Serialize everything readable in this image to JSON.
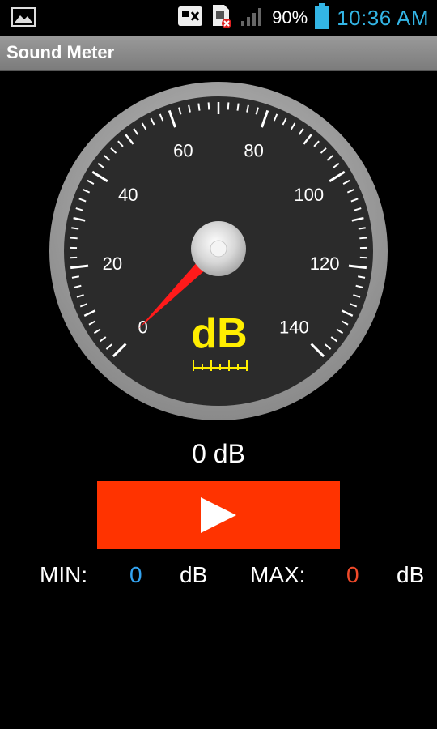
{
  "status_bar": {
    "battery_percent": "90%",
    "time": "10:36 AM",
    "icons": [
      "gallery-icon",
      "notification-icon",
      "sim-error-icon",
      "signal-icon",
      "battery-icon"
    ]
  },
  "app": {
    "title": "Sound Meter"
  },
  "gauge": {
    "unit": "dB",
    "scale_min": 0,
    "scale_max": 140,
    "tick_labels": [
      "0",
      "20",
      "40",
      "60",
      "80",
      "100",
      "120",
      "140"
    ],
    "needle_value": 0,
    "colors": {
      "unit_text": "#ffee00",
      "needle": "#ff1a1a",
      "face": "#2b2b2b",
      "rim": "#9a9a9a"
    }
  },
  "reading": {
    "text": "0 dB"
  },
  "controls": {
    "play_icon": "play-icon",
    "button_color": "#ff3300"
  },
  "stats": {
    "min_label": "MIN:",
    "min_value": "0",
    "min_unit": "dB",
    "max_label": "MAX:",
    "max_value": "0",
    "max_unit": "dB",
    "min_color": "#33a3f0",
    "max_color": "#f04a2a"
  }
}
